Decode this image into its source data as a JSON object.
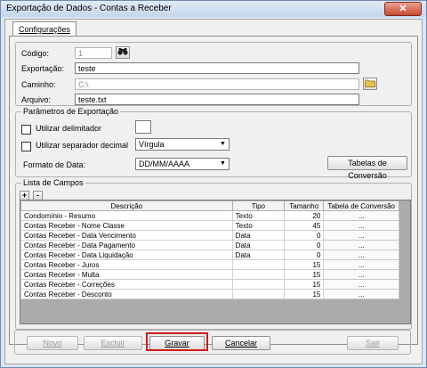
{
  "window": {
    "title": "Exportação de Dados - Contas a Receber",
    "close_glyph": "✕"
  },
  "tabs": [
    {
      "label": "Configurações"
    }
  ],
  "form": {
    "codigo_label": "Código:",
    "codigo_value": "1",
    "exportacao_label": "Exportação:",
    "exportacao_value": "teste",
    "caminho_label": "Caminho:",
    "caminho_value": "C:\\",
    "arquivo_label": "Arquivo:",
    "arquivo_value": "teste.txt"
  },
  "params": {
    "title": "Parâmetros de Exportação",
    "delimitador_label": "Utilizar delimitador",
    "separador_label": "Utilizar separador decimal",
    "separador_value": "Vírgula",
    "formato_label": "Formato de Data:",
    "formato_value": "DD/MM/AAAA",
    "tabelas_button": "Tabelas de Conversão"
  },
  "campos": {
    "title": "Lista de Campos",
    "add_glyph": "+",
    "remove_glyph": "-",
    "columns": [
      "Descrição",
      "Tipo",
      "Tamanho",
      "Tabela de Conversão"
    ],
    "rows": [
      {
        "descricao": "Condomínio - Resumo",
        "tipo": "Texto",
        "tamanho": "20",
        "conv": "..."
      },
      {
        "descricao": "Contas Receber - Nome Classe",
        "tipo": "Texto",
        "tamanho": "45",
        "conv": "..."
      },
      {
        "descricao": "Contas Receber - Data Vencimento",
        "tipo": "Data",
        "tamanho": "0",
        "conv": "..."
      },
      {
        "descricao": "Contas Receber - Data Pagamento",
        "tipo": "Data",
        "tamanho": "0",
        "conv": "..."
      },
      {
        "descricao": "Contas Receber - Data Liquidação",
        "tipo": "Data",
        "tamanho": "0",
        "conv": "..."
      },
      {
        "descricao": "Contas Receber - Juros",
        "tipo": "",
        "tamanho": "15",
        "conv": "..."
      },
      {
        "descricao": "Contas Receber - Multa",
        "tipo": "",
        "tamanho": "15",
        "conv": "..."
      },
      {
        "descricao": "Contas Receber - Correções",
        "tipo": "",
        "tamanho": "15",
        "conv": "..."
      },
      {
        "descricao": "Contas Receber - Desconto",
        "tipo": "",
        "tamanho": "15",
        "conv": "..."
      }
    ]
  },
  "buttons": {
    "novo": "Novo",
    "excluir": "Excluir",
    "gravar": "Gravar",
    "cancelar": "Cancelar",
    "sair": "Sair"
  },
  "colors": {
    "highlight": "#d01c1c",
    "folder": "#e8c44a"
  }
}
